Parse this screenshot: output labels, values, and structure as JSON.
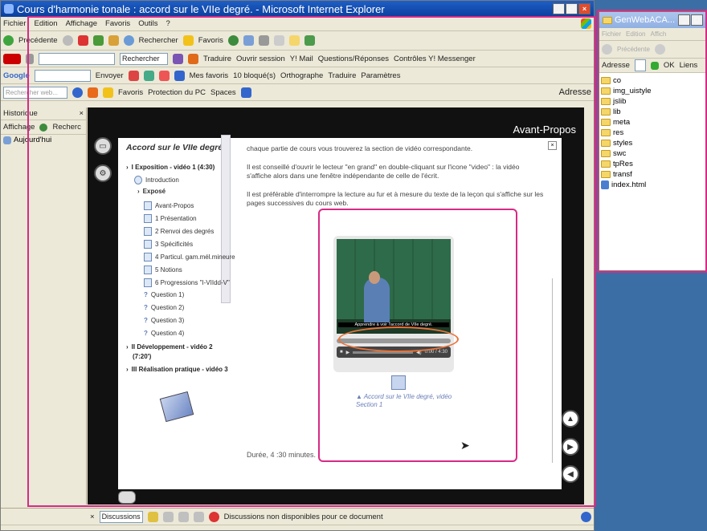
{
  "ie": {
    "title": "Cours d'harmonie tonale : accord sur le VIIe degré. - Microsoft Internet Explorer",
    "menu": [
      "Fichier",
      "Edition",
      "Affichage",
      "Favoris",
      "Outils",
      "?"
    ],
    "toolbar": {
      "back": "Précédente",
      "search": "Rechercher",
      "favorites": "Favoris"
    },
    "yahoo": {
      "search_btn": "Rechercher",
      "translate": "Traduire",
      "open_session": "Ouvrir session",
      "mail": "Y! Mail",
      "qa": "Questions/Réponses",
      "contacts": "Contrôles Y! Messenger"
    },
    "google": {
      "label": "Google",
      "send": "Envoyer",
      "bookmarks": "Mes favoris",
      "blocked": "10 bloqué(s)",
      "spell": "Orthographe",
      "translate": "Traduire",
      "settings": "Paramètres"
    },
    "search3": {
      "placeholder": "Rechercher web...",
      "favoris": "Favoris",
      "protection": "Protection du PC",
      "spaces": "Spaces",
      "address": "Adresse"
    },
    "sidepanel": {
      "history": "Historique",
      "view": "Affichage",
      "search": "Recherc",
      "today": "Aujourd'hui"
    },
    "status": {
      "discussions": "Discussions",
      "status_text": "Discussions non disponibles pour ce document"
    }
  },
  "course": {
    "header": "Avant-Propos",
    "nav_title": "Accord sur le VIIe degré.",
    "nav": [
      {
        "label": "I Exposition - vidéo 1 (4:30)"
      },
      {
        "label": "Introduction"
      },
      {
        "label": "Exposé"
      },
      {
        "label": "Avant-Propos"
      },
      {
        "label": "1 Présentation"
      },
      {
        "label": "2 Renvoi des degrés"
      },
      {
        "label": "3 Spécificités"
      },
      {
        "label": "4 Particul. gam.mél.mineure"
      },
      {
        "label": "5 Notions"
      },
      {
        "label": "6 Progressions \"I-VIIdd-V\""
      },
      {
        "label": "Question 1)"
      },
      {
        "label": "Question 2)"
      },
      {
        "label": "Question 3)"
      },
      {
        "label": "Question 4)"
      },
      {
        "label": "II Développement - vidéo 2"
      },
      {
        "label": "(7:20')"
      },
      {
        "label": "III Réalisation pratique - vidéo 3"
      }
    ],
    "paragraphs": [
      "chaque partie de cours vous trouverez la section de vidéo correspondante.",
      "Il est conseillé d'ouvrir le lecteur \"en grand\" en double-cliquant sur l'icone \"video\" : la vidéo s'affiche alors dans une fenêtre indépendante de celle de l'écrit.",
      "Il est préférable d'interrompre la lecture au fur et à mesure du texte de la leçon qui s'affiche sur les pages successives du cours web."
    ],
    "video": {
      "subtitle": "Apprendre à voir l'accord de VIIe degré.",
      "time": "0:00 / 4:30",
      "caption": "Accord sur le VIIe degré, vidéo Section 1"
    },
    "duration": "Durée, 4 :30 minutes."
  },
  "explorer": {
    "title": "GenWebACA...",
    "menu": [
      "Fichier",
      "Edition",
      "Affich"
    ],
    "back": "Précédente",
    "address_label": "Adresse",
    "ok": "OK",
    "links": "Liens",
    "files": [
      "co",
      "img_uistyle",
      "jslib",
      "lib",
      "meta",
      "res",
      "styles",
      "swc",
      "tpRes",
      "transf",
      "index.html"
    ]
  },
  "colors": {
    "highlight": "#d72a86",
    "desktop": "#3a6ea5",
    "player_ring": "#e8733a"
  }
}
